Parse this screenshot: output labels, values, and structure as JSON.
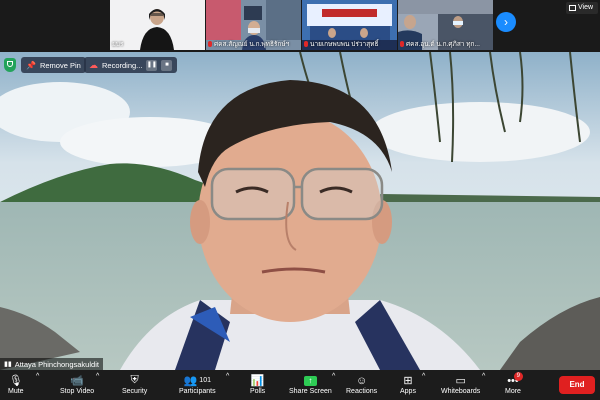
{
  "gallery": {
    "participants": [
      {
        "label": "ยบร"
      },
      {
        "label": "ศคส.สัญณย์ น.ก.พุทธิรักษ์ฯ"
      },
      {
        "label": "นายเกษพบพน ปร่วาสุทธิ์"
      },
      {
        "label": "ศคส.อุน.ต์ น.ก.ศุภิสา ทุก..."
      }
    ],
    "view_label": "View"
  },
  "overlay": {
    "remove_pin_label": "Remove Pin",
    "recording_label": "Recording...",
    "pause_glyph": "❚❚",
    "stop_glyph": "■"
  },
  "speaker": {
    "name": "Attaya Phinchongsakuldit"
  },
  "toolbar": {
    "mute": "Mute",
    "stop_video": "Stop Video",
    "security": "Security",
    "participants": "Participants",
    "participants_count": "101",
    "polls": "Polls",
    "share_screen": "Share Screen",
    "reactions": "Reactions",
    "apps": "Apps",
    "whiteboards": "Whiteboards",
    "more": "More",
    "more_badge": "9",
    "end": "End"
  },
  "colors": {
    "share_green": "#2ecc55",
    "end_red": "#e02020",
    "accent_blue": "#1a8cff"
  }
}
